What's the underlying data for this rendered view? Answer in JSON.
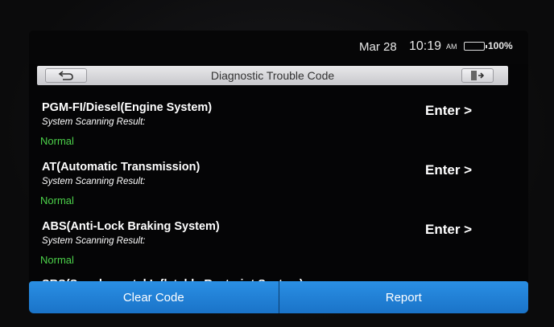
{
  "status": {
    "date": "Mar 28",
    "time": "10:19",
    "ampm": "AM",
    "battery_pct": "100%"
  },
  "header": {
    "title": "Diagnostic Trouble Code",
    "back_icon": "back-arrow-icon",
    "exit_icon": "exit-door-icon"
  },
  "systems": [
    {
      "name": "PGM-FI/Diesel(Engine System)",
      "label": "System Scanning Result:",
      "status": "Normal",
      "action": "Enter >"
    },
    {
      "name": "AT(Automatic Transmission)",
      "label": "System Scanning Result:",
      "status": "Normal",
      "action": "Enter >"
    },
    {
      "name": "ABS(Anti-Lock Braking System)",
      "label": "System Scanning Result:",
      "status": "Normal",
      "action": "Enter >"
    },
    {
      "name": "SRS(Supplemental Inflatable Restraint System)"
    }
  ],
  "footer": {
    "clear_label": "Clear Code",
    "report_label": "Report"
  },
  "colors": {
    "accent": "#1f7fd6",
    "status_ok": "#4cd14a",
    "battery": "#4cd137"
  }
}
